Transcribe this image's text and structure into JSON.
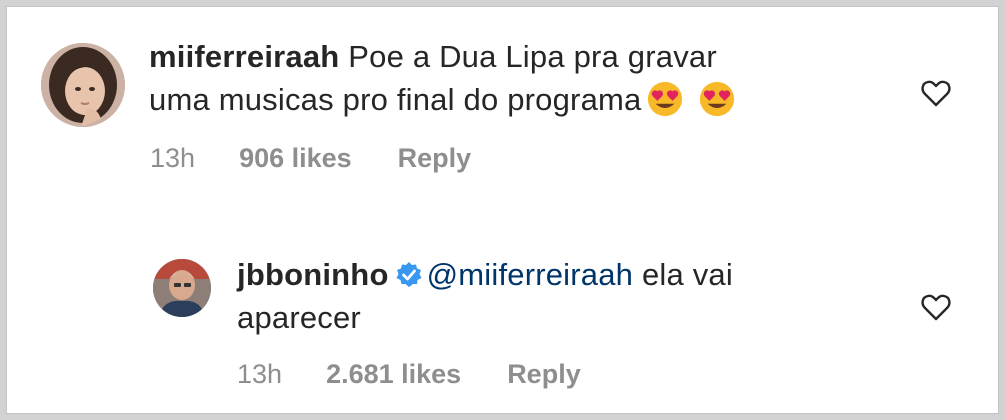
{
  "comments": [
    {
      "username": "miiferreiraah",
      "text_line1": "Poe a Dua Lipa pra gravar",
      "text_line2": "uma musicas pro final do programa",
      "emojis": [
        "heart-eyes-emoji",
        "heart-eyes-emoji"
      ],
      "time": "13h",
      "likes": "906 likes",
      "reply_label": "Reply",
      "like_icon": "heart-outline-icon"
    },
    {
      "username": "jbboninho",
      "verified": true,
      "mention": "@miiferreiraah",
      "text_rest": " ela vai",
      "text_line2": "aparecer",
      "time": "13h",
      "likes": "2.681 likes",
      "reply_label": "Reply",
      "like_icon": "heart-outline-icon"
    }
  ],
  "colors": {
    "text": "#262626",
    "muted": "#8e8e8e",
    "mention": "#003569",
    "verified": "#3897f0",
    "emoji": "#f7b928",
    "emoji_heart": "#e0245e"
  }
}
